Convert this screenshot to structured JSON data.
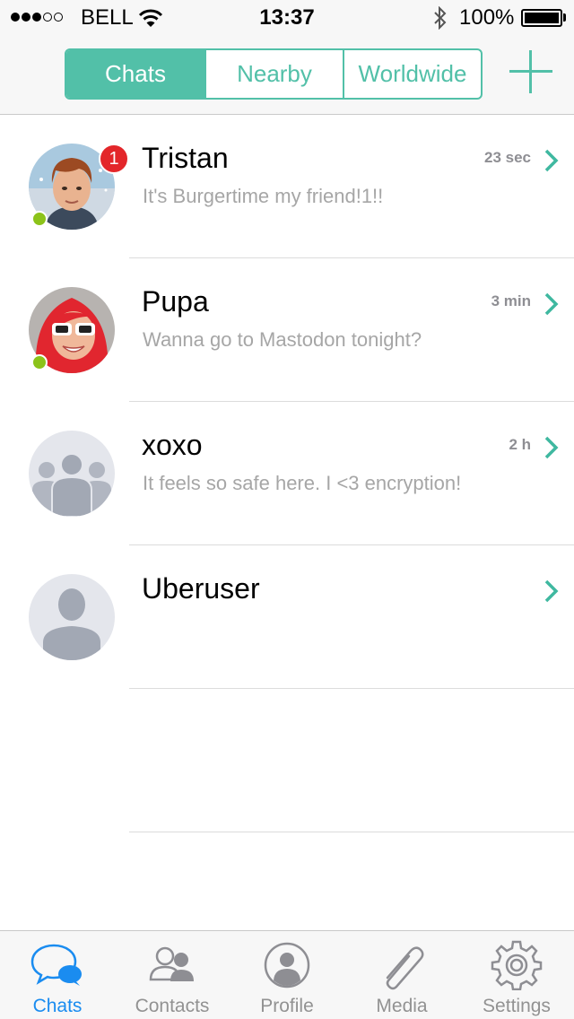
{
  "status_bar": {
    "carrier": "BELL",
    "time": "13:37",
    "battery": "100%",
    "signal_filled": 3,
    "signal_total": 5
  },
  "nav": {
    "segments": [
      {
        "label": "Chats",
        "active": true
      },
      {
        "label": "Nearby",
        "active": false
      },
      {
        "label": "Worldwide",
        "active": false
      }
    ],
    "add_icon": "plus-icon"
  },
  "colors": {
    "accent": "#52c0a8",
    "tab_active": "#1a8cf0",
    "online": "#8cc31a",
    "badge": "#e3262a"
  },
  "chats": [
    {
      "name": "Tristan",
      "message": "It's Burgertime my friend!1!!",
      "time": "23 sec",
      "unread": "1",
      "online": true,
      "avatar": "photo-boy"
    },
    {
      "name": "Pupa",
      "message": "Wanna go to Mastodon tonight?",
      "time": "3 min",
      "unread": "",
      "online": true,
      "avatar": "photo-girl"
    },
    {
      "name": "xoxo",
      "message": "It feels so safe here. I <3 encryption!",
      "time": "2 h",
      "unread": "",
      "online": false,
      "avatar": "group-placeholder"
    },
    {
      "name": "Uberuser",
      "message": "",
      "time": "",
      "unread": "",
      "online": false,
      "avatar": "person-placeholder"
    }
  ],
  "tabs": [
    {
      "label": "Chats",
      "icon": "chat-bubbles-icon",
      "active": true
    },
    {
      "label": "Contacts",
      "icon": "contacts-icon",
      "active": false
    },
    {
      "label": "Profile",
      "icon": "profile-icon",
      "active": false
    },
    {
      "label": "Media",
      "icon": "paperclip-icon",
      "active": false
    },
    {
      "label": "Settings",
      "icon": "gear-icon",
      "active": false
    }
  ]
}
